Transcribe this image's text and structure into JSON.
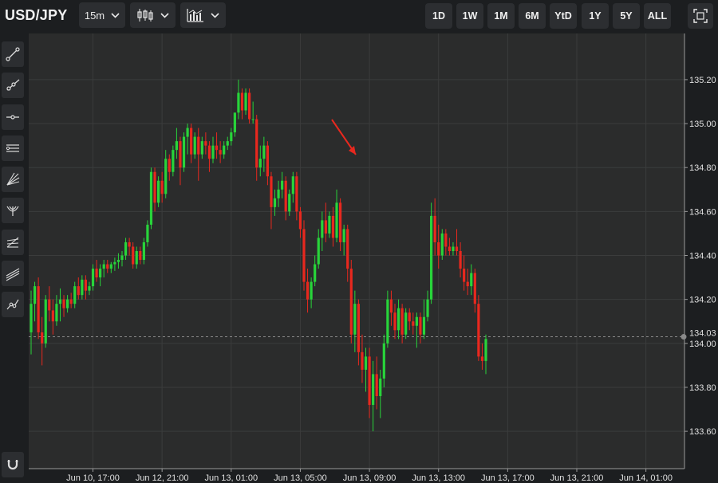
{
  "header": {
    "symbol": "USD/JPY",
    "interval": "15m",
    "chart_style_icon": "candlestick-icon",
    "indicators_icon": "indicators-icon",
    "ranges": [
      "1D",
      "1W",
      "1M",
      "6M",
      "YtD",
      "1Y",
      "5Y",
      "ALL"
    ],
    "fullscreen_icon": "fullscreen-icon"
  },
  "toolbar": {
    "tools": [
      "trend-line-icon",
      "ray-icon",
      "horizontal-line-icon",
      "parallel-channel-icon",
      "fan-icon",
      "pitchfork-icon",
      "fibonacci-icon",
      "extended-channel-icon",
      "path-icon"
    ],
    "magnet_icon": "magnet-icon"
  },
  "colors": {
    "up": "#28d43a",
    "down": "#e8281e",
    "background": "#2b2c2c",
    "grid": "#3b3c3c",
    "current_price_marker": "#8a8a8a",
    "annotation_arrow": "#e8281e"
  },
  "chart_data": {
    "type": "candlestick",
    "y_ticks": [
      135.2,
      135.0,
      134.8,
      134.6,
      134.4,
      134.2,
      134.0,
      133.8,
      133.6
    ],
    "y_tick_labels": [
      "135.20",
      "135.00",
      "134.80",
      "134.60",
      "134.40",
      "134.20",
      "134.00",
      "133.80",
      "133.60"
    ],
    "ylim": [
      133.43,
      135.41
    ],
    "x_tick_labels": [
      "Jun 10, 17:00",
      "Jun 12, 21:00",
      "Jun 13, 01:00",
      "Jun 13, 05:00",
      "Jun 13, 09:00",
      "Jun 13, 13:00",
      "Jun 13, 17:00",
      "Jun 13, 21:00",
      "Jun 14, 01:00"
    ],
    "x_tick_bar_index": [
      17,
      36,
      55,
      74,
      93,
      112,
      131,
      150,
      169
    ],
    "current_price": 134.03,
    "current_price_label": "134.03",
    "grid": true,
    "annotation": "red arrow pointing down-right near the Jun 13, 05:00 peak",
    "candles": [
      [
        134.05,
        134.24,
        133.95,
        134.18
      ],
      [
        134.18,
        134.28,
        134.1,
        134.26
      ],
      [
        134.26,
        134.3,
        134.02,
        134.05
      ],
      [
        134.05,
        134.12,
        133.9,
        134.0
      ],
      [
        134.0,
        134.22,
        133.98,
        134.2
      ],
      [
        134.2,
        134.26,
        134.1,
        134.15
      ],
      [
        134.15,
        134.2,
        134.04,
        134.1
      ],
      [
        134.1,
        134.22,
        134.08,
        134.18
      ],
      [
        134.18,
        134.25,
        134.1,
        134.2
      ],
      [
        134.2,
        134.22,
        134.12,
        134.16
      ],
      [
        134.16,
        134.22,
        134.14,
        134.2
      ],
      [
        134.2,
        134.23,
        134.16,
        134.18
      ],
      [
        134.18,
        134.28,
        134.16,
        134.26
      ],
      [
        134.26,
        134.3,
        134.2,
        134.22
      ],
      [
        134.22,
        134.31,
        134.2,
        134.29
      ],
      [
        134.29,
        134.31,
        134.2,
        134.24
      ],
      [
        134.24,
        134.28,
        134.22,
        134.26
      ],
      [
        134.26,
        134.36,
        134.24,
        134.34
      ],
      [
        134.34,
        134.38,
        134.28,
        134.3
      ],
      [
        134.3,
        134.36,
        134.26,
        134.34
      ],
      [
        134.34,
        134.38,
        134.3,
        134.36
      ],
      [
        134.36,
        134.38,
        134.32,
        134.34
      ],
      [
        134.34,
        134.37,
        134.32,
        134.36
      ],
      [
        134.36,
        134.39,
        134.33,
        134.37
      ],
      [
        134.37,
        134.41,
        134.34,
        134.38
      ],
      [
        134.38,
        134.42,
        134.35,
        134.4
      ],
      [
        134.4,
        134.48,
        134.38,
        134.46
      ],
      [
        134.46,
        134.48,
        134.4,
        134.44
      ],
      [
        134.44,
        134.46,
        134.34,
        134.36
      ],
      [
        134.36,
        134.44,
        134.34,
        134.42
      ],
      [
        134.42,
        134.44,
        134.36,
        134.38
      ],
      [
        134.38,
        134.48,
        134.36,
        134.46
      ],
      [
        134.46,
        134.56,
        134.44,
        134.54
      ],
      [
        134.54,
        134.8,
        134.52,
        134.78
      ],
      [
        134.78,
        134.8,
        134.6,
        134.64
      ],
      [
        134.64,
        134.76,
        134.62,
        134.74
      ],
      [
        134.74,
        134.78,
        134.64,
        134.68
      ],
      [
        134.68,
        134.88,
        134.66,
        134.84
      ],
      [
        134.84,
        134.86,
        134.74,
        134.78
      ],
      [
        134.78,
        134.9,
        134.76,
        134.88
      ],
      [
        134.88,
        134.98,
        134.84,
        134.92
      ],
      [
        134.92,
        134.94,
        134.72,
        134.8
      ],
      [
        134.8,
        134.96,
        134.78,
        134.94
      ],
      [
        134.94,
        135.0,
        134.86,
        134.98
      ],
      [
        134.98,
        135.0,
        134.82,
        134.86
      ],
      [
        134.86,
        134.96,
        134.84,
        134.94
      ],
      [
        134.94,
        134.98,
        134.74,
        134.86
      ],
      [
        134.86,
        134.94,
        134.84,
        134.92
      ],
      [
        134.92,
        134.96,
        134.86,
        134.9
      ],
      [
        134.9,
        134.92,
        134.78,
        134.84
      ],
      [
        134.84,
        134.94,
        134.82,
        134.9
      ],
      [
        134.9,
        134.96,
        134.84,
        134.88
      ],
      [
        134.88,
        134.92,
        134.82,
        134.86
      ],
      [
        134.86,
        134.92,
        134.84,
        134.9
      ],
      [
        134.9,
        134.94,
        134.88,
        134.92
      ],
      [
        134.92,
        134.98,
        134.9,
        134.96
      ],
      [
        134.96,
        135.04,
        134.94,
        135.05
      ],
      [
        135.05,
        135.2,
        135.02,
        135.14
      ],
      [
        135.14,
        135.16,
        135.02,
        135.06
      ],
      [
        135.06,
        135.16,
        135.04,
        135.14
      ],
      [
        135.14,
        135.16,
        135.0,
        135.02
      ],
      [
        135.02,
        135.1,
        135.0,
        135.02
      ],
      [
        135.02,
        135.04,
        134.74,
        134.8
      ],
      [
        134.8,
        134.9,
        134.76,
        134.84
      ],
      [
        134.84,
        134.94,
        134.78,
        134.9
      ],
      [
        134.9,
        134.92,
        134.72,
        134.76
      ],
      [
        134.76,
        134.78,
        134.52,
        134.62
      ],
      [
        134.62,
        134.7,
        134.58,
        134.66
      ],
      [
        134.66,
        134.74,
        134.62,
        134.7
      ],
      [
        134.7,
        134.78,
        134.66,
        134.74
      ],
      [
        134.74,
        134.76,
        134.56,
        134.6
      ],
      [
        134.6,
        134.7,
        134.58,
        134.68
      ],
      [
        134.68,
        134.78,
        134.64,
        134.76
      ],
      [
        134.76,
        134.78,
        134.56,
        134.6
      ],
      [
        134.6,
        134.62,
        134.48,
        134.52
      ],
      [
        134.52,
        134.56,
        134.24,
        134.28
      ],
      [
        134.28,
        134.34,
        134.14,
        134.2
      ],
      [
        134.2,
        134.3,
        134.16,
        134.28
      ],
      [
        134.28,
        134.4,
        134.26,
        134.36
      ],
      [
        134.36,
        134.52,
        134.34,
        134.48
      ],
      [
        134.48,
        134.6,
        134.42,
        134.56
      ],
      [
        134.56,
        134.64,
        134.46,
        134.5
      ],
      [
        134.5,
        134.6,
        134.48,
        134.58
      ],
      [
        134.58,
        134.62,
        134.44,
        134.48
      ],
      [
        134.48,
        134.7,
        134.46,
        134.64
      ],
      [
        134.64,
        134.66,
        134.42,
        134.46
      ],
      [
        134.46,
        134.54,
        134.4,
        134.52
      ],
      [
        134.52,
        134.54,
        134.28,
        134.34
      ],
      [
        134.34,
        134.38,
        134.0,
        134.04
      ],
      [
        134.04,
        134.24,
        133.96,
        134.18
      ],
      [
        134.18,
        134.2,
        133.9,
        133.96
      ],
      [
        133.96,
        134.04,
        133.82,
        133.88
      ],
      [
        133.88,
        133.98,
        133.78,
        133.94
      ],
      [
        133.94,
        133.98,
        133.66,
        133.72
      ],
      [
        133.72,
        133.92,
        133.6,
        133.86
      ],
      [
        133.86,
        133.94,
        133.7,
        133.76
      ],
      [
        133.76,
        133.88,
        133.66,
        133.84
      ],
      [
        133.84,
        134.04,
        133.8,
        134.0
      ],
      [
        134.0,
        134.24,
        133.98,
        134.2
      ],
      [
        134.2,
        134.24,
        134.08,
        134.14
      ],
      [
        134.14,
        134.18,
        134.02,
        134.06
      ],
      [
        134.06,
        134.2,
        134.02,
        134.16
      ],
      [
        134.16,
        134.18,
        134.0,
        134.04
      ],
      [
        134.04,
        134.16,
        134.02,
        134.14
      ],
      [
        134.14,
        134.16,
        134.06,
        134.1
      ],
      [
        134.1,
        134.14,
        134.04,
        134.08
      ],
      [
        134.08,
        134.14,
        133.98,
        134.12
      ],
      [
        134.12,
        134.14,
        134.0,
        134.04
      ],
      [
        134.04,
        134.2,
        134.02,
        134.12
      ],
      [
        134.12,
        134.24,
        134.1,
        134.2
      ],
      [
        134.2,
        134.64,
        134.18,
        134.58
      ],
      [
        134.58,
        134.66,
        134.4,
        134.46
      ],
      [
        134.46,
        134.54,
        134.34,
        134.4
      ],
      [
        134.4,
        134.52,
        134.38,
        134.5
      ],
      [
        134.5,
        134.52,
        134.4,
        134.44
      ],
      [
        134.44,
        134.48,
        134.4,
        134.42
      ],
      [
        134.42,
        134.46,
        134.4,
        134.44
      ],
      [
        134.44,
        134.52,
        134.4,
        134.42
      ],
      [
        134.42,
        134.46,
        134.3,
        134.34
      ],
      [
        134.34,
        134.4,
        134.24,
        134.28
      ],
      [
        134.28,
        134.34,
        134.22,
        134.26
      ],
      [
        134.26,
        134.36,
        134.22,
        134.32
      ],
      [
        134.32,
        134.34,
        134.14,
        134.18
      ],
      [
        134.18,
        134.22,
        133.92,
        133.94
      ],
      [
        133.94,
        134.0,
        133.88,
        133.92
      ],
      [
        133.92,
        134.04,
        133.86,
        134.02
      ]
    ]
  }
}
